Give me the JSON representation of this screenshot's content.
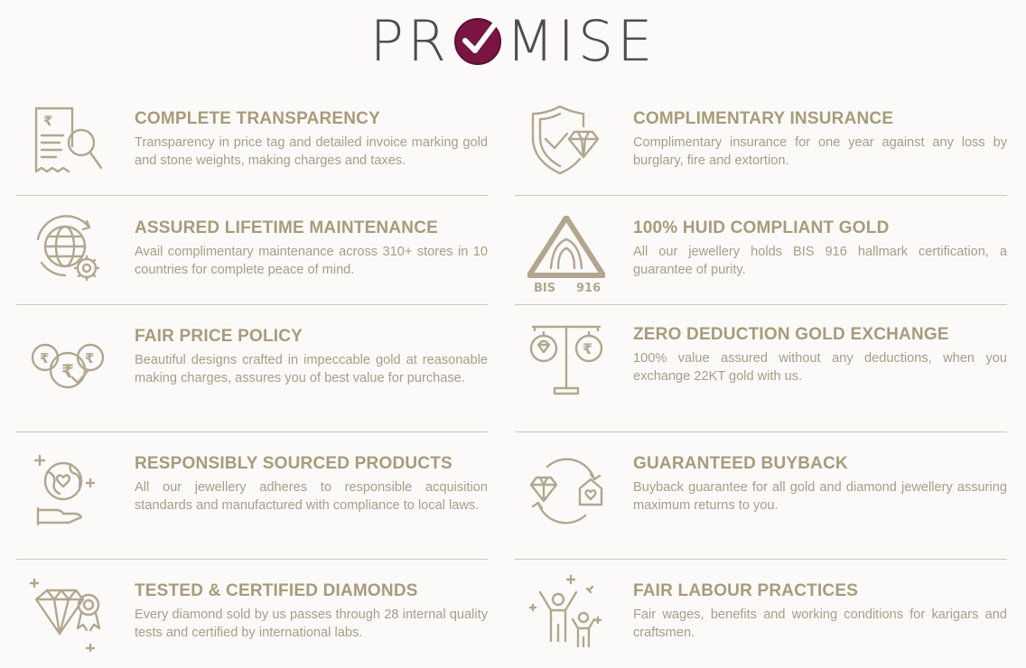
{
  "brand": {
    "before": "PR",
    "after": "MISE"
  },
  "colors": {
    "gold": "#a89b7a",
    "text": "#a89d88",
    "logo_gray": "#4b4f52",
    "logo_accent": "#7a1543",
    "divider": "#cfc7b8"
  },
  "left": [
    {
      "icon": "invoice-search-icon",
      "title": "COMPLETE TRANSPARENCY",
      "desc": "Transparency in price tag and detailed invoice marking gold and stone weights, making charges and taxes."
    },
    {
      "icon": "globe-gear-icon",
      "title": "ASSURED LIFETIME MAINTENANCE",
      "desc": "Avail complimentary maintenance across 310+ stores in 10 countries for complete peace of mind."
    },
    {
      "icon": "rupee-coins-icon",
      "title": "FAIR PRICE POLICY",
      "desc": "Beautiful designs crafted in impeccable gold at reasonable making charges, assures you of best value for purchase."
    },
    {
      "icon": "earth-hand-icon",
      "title": "RESPONSIBLY SOURCED PRODUCTS",
      "desc": "All our jewellery adheres to responsible acquisition standards and manufactured with compliance to local laws."
    },
    {
      "icon": "diamond-badge-icon",
      "title": "TESTED & CERTIFIED DIAMONDS",
      "desc": "Every diamond sold by us passes through 28 internal quality tests and certified by international labs."
    }
  ],
  "right": [
    {
      "icon": "shield-diamond-icon",
      "title": "COMPLIMENTARY INSURANCE",
      "desc": "Complimentary insurance for one year against any loss by burglary, fire and extortion."
    },
    {
      "icon": "bis-hallmark-icon",
      "title": "100% HUID COMPLIANT GOLD",
      "desc": "All our jewellery holds BIS 916 hallmark certification, a guarantee of purity.",
      "bis_left": "BIS",
      "bis_right": "916"
    },
    {
      "icon": "balance-scale-icon",
      "title": "ZERO DEDUCTION GOLD EXCHANGE",
      "desc": "100% value assured without any deductions, when you exchange 22KT gold with us."
    },
    {
      "icon": "buyback-cycle-icon",
      "title": "GUARANTEED BUYBACK",
      "desc": "Buyback guarantee for all gold and diamond jewellery assuring maximum returns to you."
    },
    {
      "icon": "workers-icon",
      "title": "FAIR LABOUR PRACTICES",
      "desc": "Fair wages, benefits and working conditions for karigars and craftsmen."
    }
  ]
}
